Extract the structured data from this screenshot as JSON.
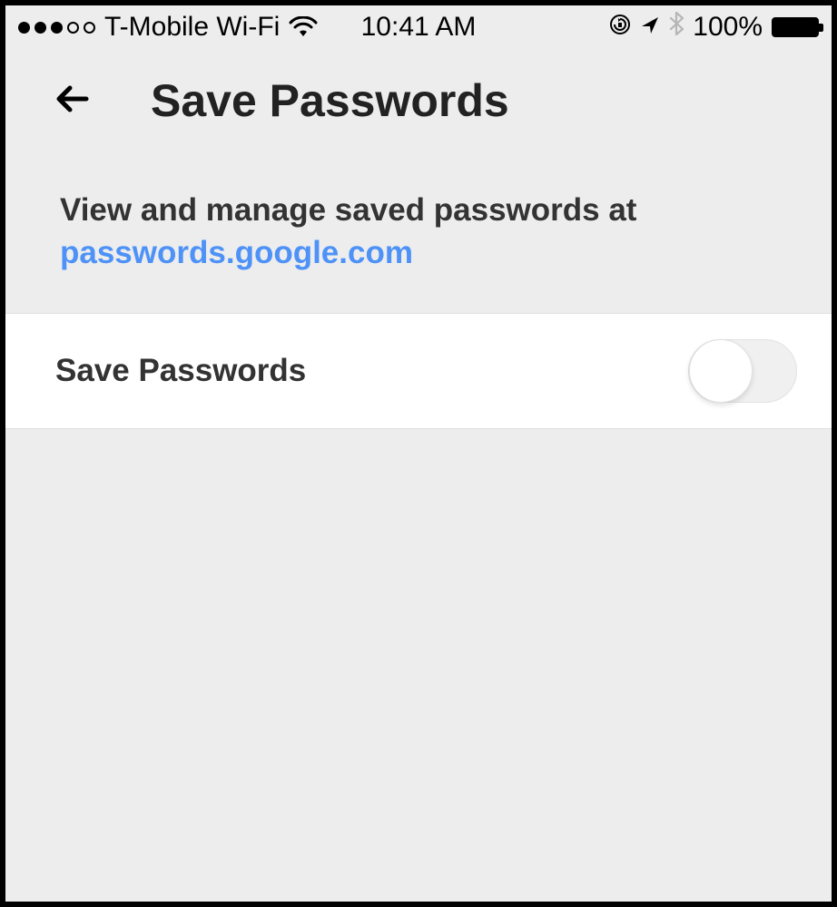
{
  "status_bar": {
    "carrier": "T-Mobile Wi-Fi",
    "time": "10:41 AM",
    "battery_pct": "100%"
  },
  "header": {
    "title": "Save Passwords"
  },
  "description": {
    "text": "View and manage saved passwords at ",
    "link": "passwords.google.com"
  },
  "setting": {
    "label": "Save Passwords",
    "enabled": false
  }
}
